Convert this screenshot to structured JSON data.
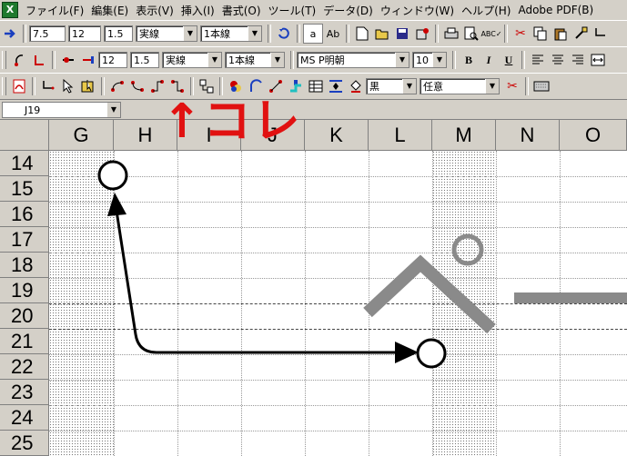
{
  "menubar": {
    "items": [
      "ファイル(F)",
      "編集(E)",
      "表示(V)",
      "挿入(I)",
      "書式(O)",
      "ツール(T)",
      "データ(D)",
      "ウィンドウ(W)",
      "ヘルプ(H)",
      "Adobe PDF(B)"
    ]
  },
  "toolbar1": {
    "size1": "7.5",
    "size2": "12",
    "size3": "1.5",
    "line_style": "実線",
    "line_count": "1本線"
  },
  "toolbar2": {
    "size1": "12",
    "size2": "1.5",
    "line_style": "実線",
    "line_count": "1本線",
    "font_name": "MS P明朝",
    "font_size": "10",
    "bold": "B",
    "italic": "I",
    "underline": "U"
  },
  "toolbar3": {
    "color": "黒",
    "option": "任意"
  },
  "namebox": {
    "value": "J19"
  },
  "columns": [
    "G",
    "H",
    "I",
    "J",
    "K",
    "L",
    "M",
    "N",
    "O"
  ],
  "rows": [
    "14",
    "15",
    "16",
    "17",
    "18",
    "19",
    "20",
    "21",
    "22",
    "23",
    "24",
    "25"
  ],
  "annotation": {
    "text": "↑コレ",
    "color": "#e11111"
  }
}
